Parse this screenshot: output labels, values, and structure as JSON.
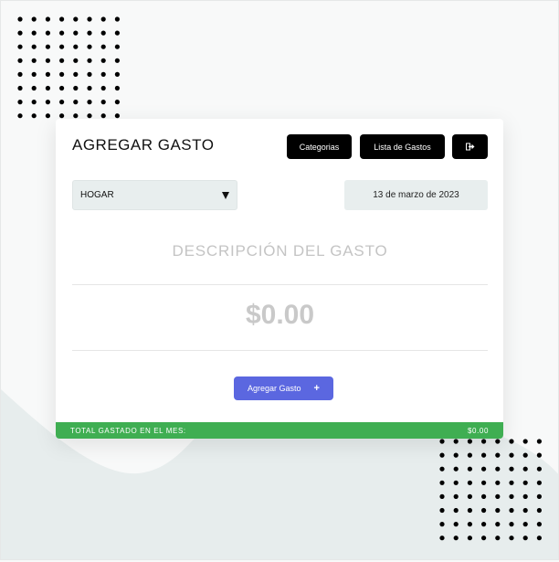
{
  "header": {
    "title": "AGREGAR GASTO",
    "buttons": {
      "categories_label": "Categorias",
      "expense_list_label": "Lista de Gastos",
      "logout_icon": "logout-icon"
    }
  },
  "form": {
    "category_selected": "HOGAR",
    "date_value": "13 de marzo de 2023",
    "description_placeholder": "DESCRIPCIÓN DEL GASTO",
    "amount_placeholder": "$0.00",
    "submit_label": "Agregar Gasto",
    "submit_icon": "+"
  },
  "footer": {
    "total_label": "TOTAL GASTADO EN EL MES:",
    "total_value": "$0.00"
  },
  "colors": {
    "accent": "#5b67e0",
    "success": "#3fae52",
    "dark_button": "#000000",
    "input_background": "#e8eeee"
  }
}
